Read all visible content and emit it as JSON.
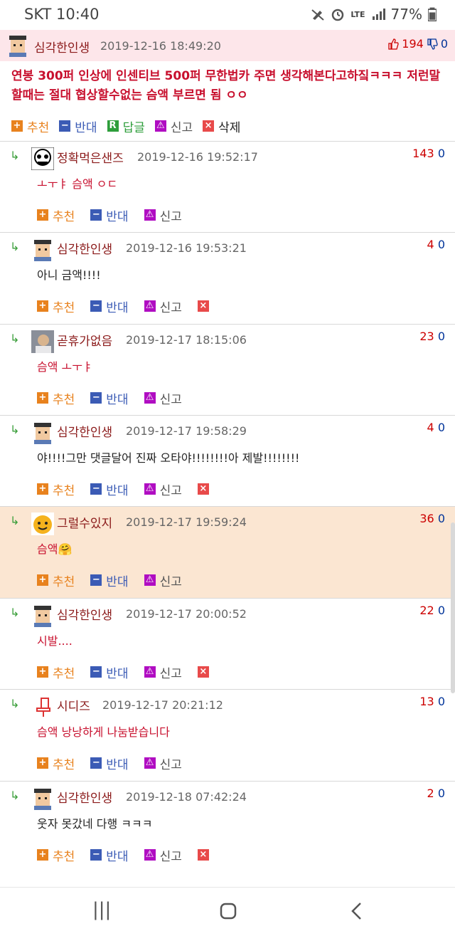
{
  "status": {
    "carrier": "SKT",
    "time": "10:40",
    "network": "LTE",
    "battery": "77%"
  },
  "post": {
    "nick": "심각한인생",
    "date": "2019-12-16 18:49:20",
    "up": "194",
    "down": "0",
    "body": "연봉 300퍼 인상에 인센티브 500퍼 무한법카 주면 생각해본다고하짘ㅋㅋㅋ 저런말할때는 절대 협상할수없는 슴액 부르면 됨 ㅇㅇ",
    "actions": {
      "recommend": "추천",
      "oppose": "반대",
      "reply": "답글",
      "report": "신고",
      "delete": "삭제"
    }
  },
  "labels": {
    "recommend": "추천",
    "oppose": "반대",
    "report": "신고"
  },
  "comments": [
    {
      "nick": "정확먹은샌즈",
      "date": "2019-12-16 19:52:17",
      "up": "143",
      "down": "0",
      "text": "ㅗㅜㅑ 슴액 ㅇㄷ"
    },
    {
      "nick": "심각한인생",
      "date": "2019-12-16 19:53:21",
      "up": "4",
      "down": "0",
      "text": "아니 금액!!!!"
    },
    {
      "nick": "곧휴가없음",
      "date": "2019-12-17 18:15:06",
      "up": "23",
      "down": "0",
      "text": "슴액 ㅗㅜㅑ"
    },
    {
      "nick": "심각한인생",
      "date": "2019-12-17 19:58:29",
      "up": "4",
      "down": "0",
      "text": "야!!!!그만 댓글달어 진짜 오타야!!!!!!!!아 제발!!!!!!!!"
    },
    {
      "nick": "그럴수있지",
      "date": "2019-12-17 19:59:24",
      "up": "36",
      "down": "0",
      "text": "슴액🤗"
    },
    {
      "nick": "심각한인생",
      "date": "2019-12-17 20:00:52",
      "up": "22",
      "down": "0",
      "text": "시발...."
    },
    {
      "nick": "시디즈",
      "date": "2019-12-17 20:21:12",
      "up": "13",
      "down": "0",
      "text": "슴액 낭낭하게 나눔받습니다"
    },
    {
      "nick": "심각한인생",
      "date": "2019-12-18 07:42:24",
      "up": "2",
      "down": "0",
      "text": "웃자 못갔네 다행 ㅋㅋㅋ"
    }
  ]
}
